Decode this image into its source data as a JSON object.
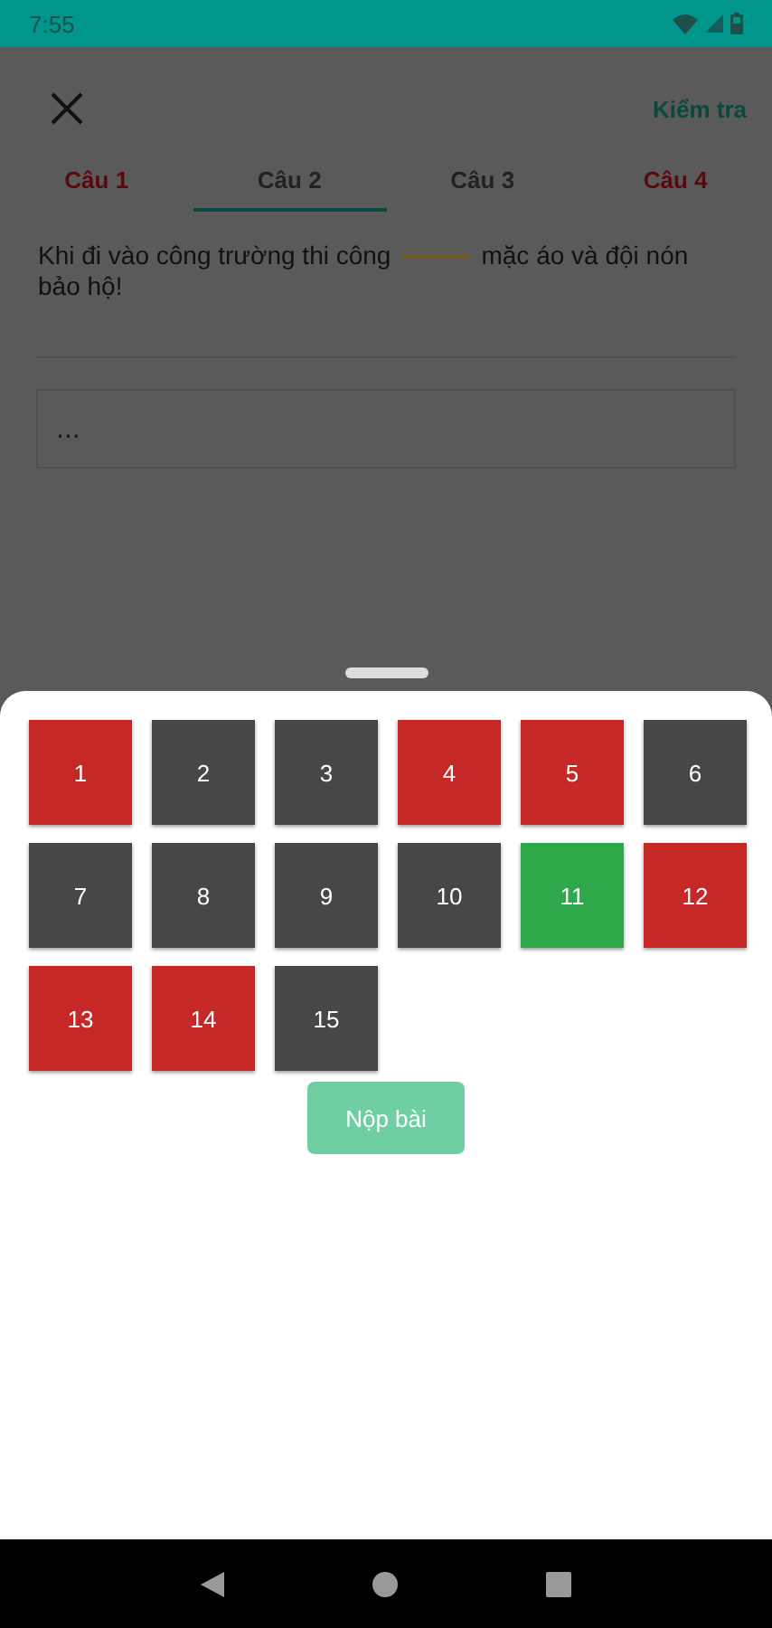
{
  "status_bar": {
    "time": "7:55"
  },
  "header": {
    "check_label": "Kiểm tra"
  },
  "tabs": [
    {
      "label": "Câu 1",
      "selected": false,
      "color": "#5a0810"
    },
    {
      "label": "Câu 2",
      "selected": true,
      "color": "#222222"
    },
    {
      "label": "Câu 3",
      "selected": false,
      "color": "#222222"
    },
    {
      "label": "Câu 4",
      "selected": false,
      "color": "#5a0810"
    }
  ],
  "question": {
    "text_before": "Khi đi vào công trường thi công",
    "text_after": "mặc áo và đội nón bảo hộ!"
  },
  "answer_field": {
    "placeholder": "..."
  },
  "answer_sheet": {
    "questions": [
      {
        "number": "1",
        "color": "#c62828"
      },
      {
        "number": "2",
        "color": "#474747"
      },
      {
        "number": "3",
        "color": "#474747"
      },
      {
        "number": "4",
        "color": "#c62828"
      },
      {
        "number": "5",
        "color": "#c62828"
      },
      {
        "number": "6",
        "color": "#474747"
      },
      {
        "number": "7",
        "color": "#474747"
      },
      {
        "number": "8",
        "color": "#474747"
      },
      {
        "number": "9",
        "color": "#474747"
      },
      {
        "number": "10",
        "color": "#474747"
      },
      {
        "number": "11",
        "color": "#2ea84a"
      },
      {
        "number": "12",
        "color": "#c62828"
      },
      {
        "number": "13",
        "color": "#c62828"
      },
      {
        "number": "14",
        "color": "#c62828"
      },
      {
        "number": "15",
        "color": "#474747"
      }
    ],
    "submit": {
      "label": "Nộp bài",
      "disabled": true
    }
  }
}
